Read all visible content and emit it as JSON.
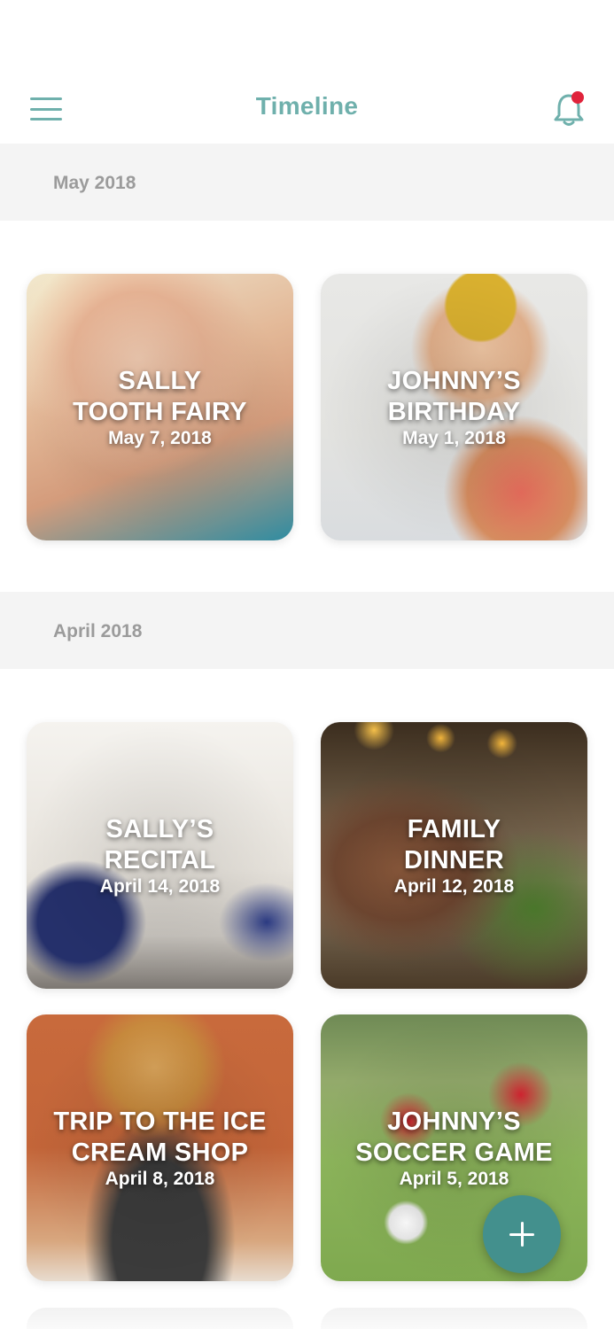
{
  "header": {
    "title": "Timeline",
    "menu_icon": "hamburger-menu-icon",
    "notification_icon": "bell-icon",
    "notification_badge_color": "#e0233b",
    "accent_color": "#6fb0ac"
  },
  "sections": [
    {
      "label": "May 2018",
      "cards": [
        {
          "title": "SALLY\nTOOTH FAIRY",
          "date": "May 7, 2018"
        },
        {
          "title": "JOHNNY’S\nBIRTHDAY",
          "date": "May 1, 2018"
        }
      ]
    },
    {
      "label": "April 2018",
      "cards": [
        {
          "title": "SALLY’S\nRECITAL",
          "date": "April 14, 2018"
        },
        {
          "title": "FAMILY\nDINNER",
          "date": "April 12, 2018"
        },
        {
          "title": "TRIP TO THE ICE\nCREAM SHOP",
          "date": "April 8, 2018"
        },
        {
          "title": "JOHNNY’S\nSOCCER GAME",
          "date": "April 5, 2018"
        }
      ]
    }
  ],
  "fab": {
    "icon": "plus-icon",
    "color": "#43908d"
  }
}
